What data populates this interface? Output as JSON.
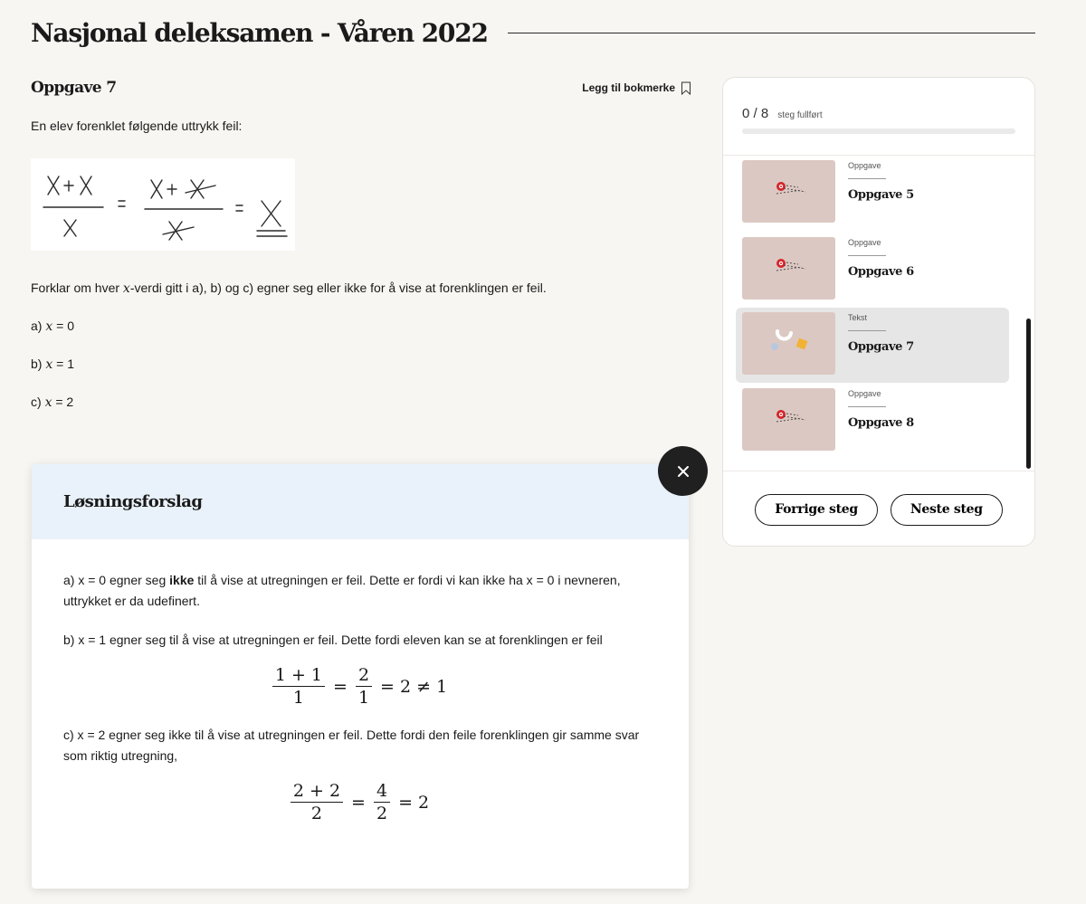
{
  "page": {
    "title": "Nasjonal deleksamen - Våren 2022"
  },
  "task": {
    "title": "Oppgave 7",
    "bookmark_label": "Legg til bokmerke",
    "intro": "En elev forenklet følgende uttrykk feil:",
    "question_pre": "Forklar om hver ",
    "question_var": "x",
    "question_post": "-verdi gitt i a), b) og c) egner seg eller ikke for å vise at forenklingen er feil.",
    "options": [
      {
        "label": "a) ",
        "var": "x",
        "value": " = 0"
      },
      {
        "label": "b) ",
        "var": "x",
        "value": " = 1"
      },
      {
        "label": "c) ",
        "var": "x",
        "value": " = 2"
      }
    ]
  },
  "solution": {
    "title": "Løsningsforslag",
    "a_pre": "a) x = 0 egner seg ",
    "a_bold": "ikke",
    "a_post": " til å vise at utregningen er feil. Dette er fordi vi kan ikke ha x = 0 i nevneren, uttrykket er da udefinert.",
    "b_text": "b) x = 1 egner seg til å vise at utregningen er feil. Dette fordi eleven kan se at forenklingen er feil",
    "b_eq": {
      "n1": "1 + 1",
      "d1": "1",
      "eq1": "=",
      "n2": "2",
      "d2": "1",
      "rest": "= 2 ≠ 1"
    },
    "c_text": "c) x = 2 egner seg ikke til å vise at utregningen er feil. Dette fordi den feile forenklingen gir samme svar som riktig utregning,",
    "c_eq": {
      "n1": "2 + 2",
      "d1": "2",
      "eq1": "=",
      "n2": "4",
      "d2": "2",
      "rest": "= 2"
    }
  },
  "progress": {
    "count": "0 / 8",
    "label": "steg fullført",
    "fraction": 0
  },
  "steps": [
    {
      "type": "Oppgave",
      "title": "Oppgave 5",
      "active": false
    },
    {
      "type": "Oppgave",
      "title": "Oppgave 6",
      "active": false
    },
    {
      "type": "Tekst",
      "title": "Oppgave 7",
      "active": true
    },
    {
      "type": "Oppgave",
      "title": "Oppgave 8",
      "active": false
    }
  ],
  "nav": {
    "prev_label": "Forrige steg",
    "next_label": "Neste steg"
  },
  "icons": {
    "close": "close-icon",
    "bookmark": "bookmark-icon",
    "target": "target-icon",
    "shapes": "shapes-icon"
  }
}
